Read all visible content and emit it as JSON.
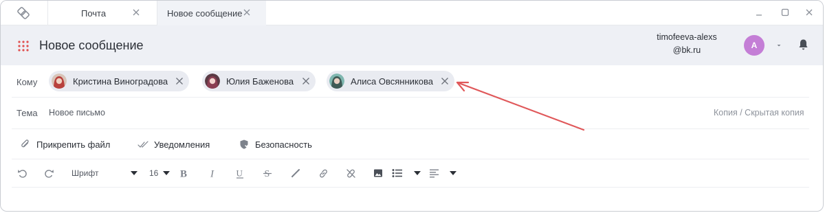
{
  "tabs": [
    {
      "label": "Почта",
      "active": false
    },
    {
      "label": "Новое сообщение",
      "active": true
    }
  ],
  "header": {
    "title": "Новое сообщение",
    "account_email": "timofeeva-alexs@bk.ru",
    "avatar_letter": "A"
  },
  "compose": {
    "to_label": "Кому",
    "recipients": [
      {
        "name": "Кристина Виноградова",
        "avatar_color": "#b8413d"
      },
      {
        "name": "Юлия Баженова",
        "avatar_color": "#8a3e52"
      },
      {
        "name": "Алиса Овсянникова",
        "avatar_color": "#3f7f7a"
      }
    ],
    "subject_label": "Тема",
    "subject_value": "Новое письмо",
    "cc_link": "Копия / Скрытая копия"
  },
  "options": {
    "attach": "Прикрепить файл",
    "notifications": "Уведомления",
    "security": "Безопасность"
  },
  "toolbar": {
    "font": "Шрифт",
    "font_size": "16",
    "icons": [
      "undo-icon",
      "redo-icon",
      "bold-icon",
      "italic-icon",
      "underline-icon",
      "strikethrough-icon",
      "text-color-icon",
      "link-icon",
      "unlink-icon",
      "image-icon",
      "list-icon",
      "align-icon"
    ]
  },
  "colors": {
    "header_bg": "#eef0f5",
    "avatar": "#c47ed6",
    "chip_bg": "#e9ebf1",
    "annotation": "#e0585a"
  }
}
